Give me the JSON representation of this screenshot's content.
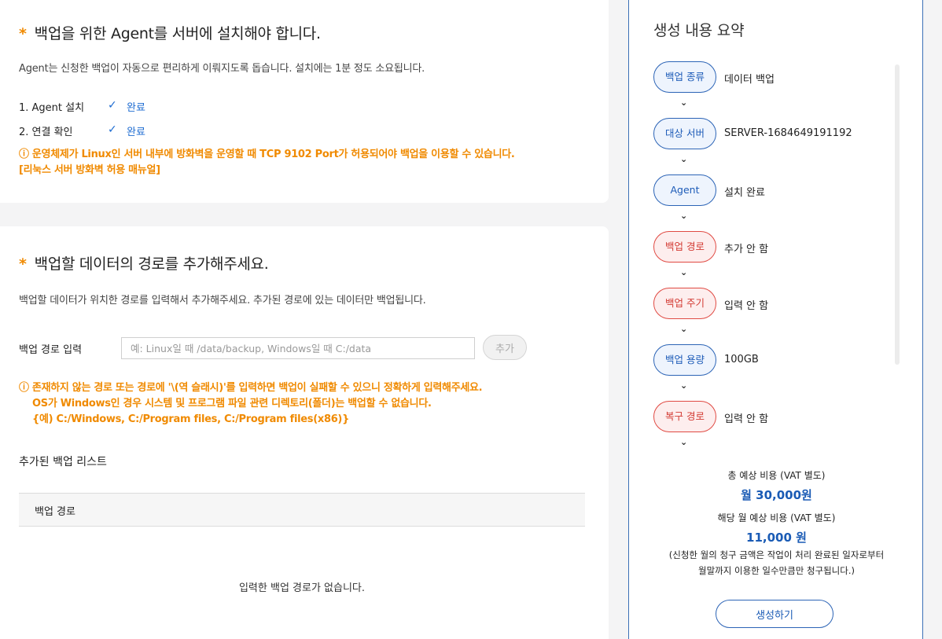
{
  "agent_section": {
    "star": "*",
    "title": "백업을 위한 Agent를 서버에 설치해야 합니다.",
    "desc": "Agent는 신청한 백업이 자동으로 편리하게 이뤄지도록 돕습니다. 설치에는 1분 정도 소요됩니다.",
    "steps": [
      {
        "label": "1. Agent 설치",
        "check": "✓",
        "status": "완료"
      },
      {
        "label": "2. 연결 확인",
        "check": "✓",
        "status": "완료"
      }
    ],
    "warning": "ⓘ 운영체제가 Linux인 서버 내부에 방화벽을 운영할 때 TCP 9102 Port가 허용되어야 백업을 이용할 수 있습니다.",
    "manual_link": "[리눅스 서버 방화벽 허용 매뉴얼]"
  },
  "path_section": {
    "star": "*",
    "title": "백업할 데이터의 경로를 추가해주세요.",
    "desc": "백업할 데이터가 위치한 경로를 입력해서 추가해주세요. 추가된 경로에 있는 데이터만 백업됩니다.",
    "input_label": "백업 경로 입력",
    "input_value": "",
    "input_placeholder": "예: Linux일 때 /data/backup, Windows일 때 C:/data",
    "add_label": "추가",
    "warnings": [
      "ⓘ 존재하지 않는 경로 또는 경로에 '\\(역 슬래시)'를 입력하면 백업이 실패할 수 있으니 정확하게 입력해주세요.",
      "OS가 Windows인 경우 시스템 및 프로그램 파일 관련 디렉토리(폴더)는 백업할 수 없습니다.",
      "{예) C:/Windows, C:/Program files, C:/Program files(x86)}"
    ],
    "list_title": "추가된 백업 리스트",
    "table_header": "백업 경로",
    "empty_message": "입력한 백업 경로가 없습니다."
  },
  "summary": {
    "title": "생성 내용 요약",
    "chevron": "⌄",
    "items": [
      {
        "badge": "백업 종류",
        "value": "데이터 백업",
        "tone": "blue"
      },
      {
        "badge": "대상 서버",
        "value": "SERVER-1684649191192",
        "tone": "blue"
      },
      {
        "badge": "Agent",
        "value": "설치 완료",
        "tone": "blue"
      },
      {
        "badge": "백업 경로",
        "value": "추가 안 함",
        "tone": "red"
      },
      {
        "badge": "백업 주기",
        "value": "입력 안 함",
        "tone": "red"
      },
      {
        "badge": "백업 용량",
        "value": "100GB",
        "tone": "blue"
      },
      {
        "badge": "복구 경로",
        "value": "입력 안 함",
        "tone": "red"
      }
    ],
    "total_label": "총 예상 비용 (VAT 별도)",
    "total_value": "월 30,000원",
    "month_label": "해당 월 예상 비용 (VAT 별도)",
    "month_value": "11,000 원",
    "note_line1": "(신청한 월의 청구 금액은 작업이 처리 완료된 일자로부터",
    "note_line2": "월말까지 이용한 일수만큼만 청구됩니다.)",
    "create_label": "생성하기",
    "colors": {
      "blue": "#1d5bb8",
      "red": "#d33a33",
      "warning": "#f08a00"
    }
  }
}
